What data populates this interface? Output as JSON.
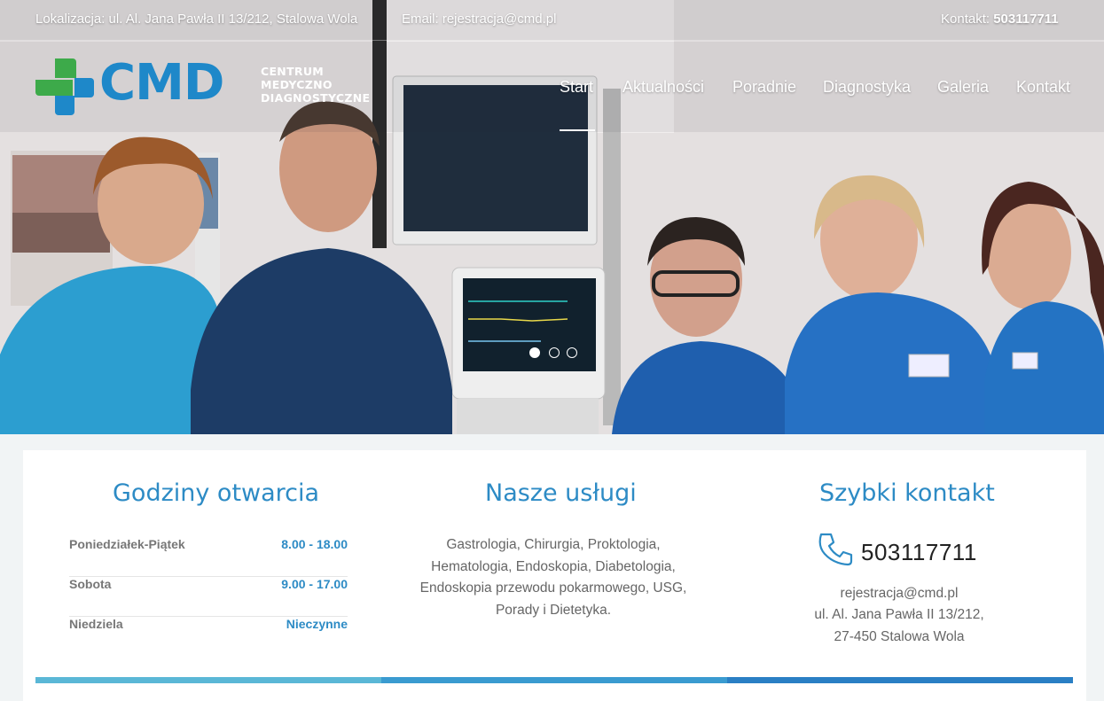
{
  "topbar": {
    "location": "Lokalizacja: ul. Al. Jana Pawła II 13/212, Stalowa Wola",
    "email": "Email: rejestracja@cmd.pl",
    "contact_label": "Kontakt: ",
    "contact_phone": "503117711"
  },
  "logo": {
    "brand": "CMD",
    "line1": "CENTRUM",
    "line2": "MEDYCZNO",
    "line3": "DIAGNOSTYCZNE"
  },
  "nav": {
    "items": [
      "Start",
      "Aktualności",
      "Poradnie",
      "Diagnostyka",
      "Galeria",
      "Kontakt"
    ],
    "active": "Start"
  },
  "hero": {
    "image": "medical-team-photo",
    "slides": 3,
    "active_slide": 1
  },
  "hours": {
    "title": "Godziny otwarcia",
    "rows": [
      {
        "day": "Poniedziałek-Piątek",
        "time": "8.00 - 18.00"
      },
      {
        "day": "Sobota",
        "time": "9.00 - 17.00"
      },
      {
        "day": "Niedziela",
        "time": "Nieczynne"
      }
    ]
  },
  "services": {
    "title": "Nasze usługi",
    "lines": [
      "Gastrologia, Chirurgia, Proktologia,",
      "Hematologia, Endoskopia, Diabetologia,",
      "Endoskopia przewodu pokarmowego, USG,",
      "Porady i Dietetyka."
    ]
  },
  "quick_contact": {
    "title": "Szybki kontakt",
    "phone": "503117711",
    "email": "rejestracja@cmd.pl",
    "address1": "ul. Al. Jana Pawła II 13/212,",
    "address2": "27-450 Stalowa Wola"
  },
  "colors": {
    "accent": "#2d8bc5",
    "logo_blue": "#1e88c9",
    "logo_green": "#3daa4a",
    "bar1": "#5ab7d6",
    "bar2": "#3a9bd0",
    "bar3": "#2a7fc4"
  },
  "icons": {
    "phone": "phone-icon"
  }
}
